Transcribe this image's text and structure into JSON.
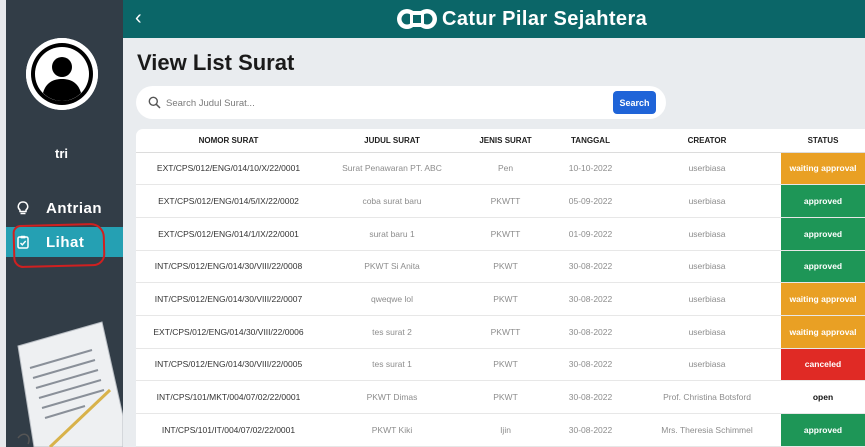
{
  "app": {
    "brand": "Catur Pilar Sejahtera"
  },
  "sidebar": {
    "username": "tri",
    "items": [
      {
        "label": "Antrian",
        "icon": "lightbulb-icon"
      },
      {
        "label": "Lihat",
        "icon": "clipboard-icon",
        "active": true
      }
    ]
  },
  "page": {
    "title": "View List Surat",
    "search": {
      "placeholder": "Search Judul Surat...",
      "button": "Search"
    }
  },
  "table": {
    "headers": [
      "NOMOR SURAT",
      "JUDUL SURAT",
      "JENIS SURAT",
      "TANGGAL",
      "CREATOR",
      "STATUS"
    ],
    "rows": [
      {
        "nomor": "EXT/CPS/012/ENG/014/10/X/22/0001",
        "judul": "Surat Penawaran PT. ABC",
        "jenis": "Pen",
        "tanggal": "10-10-2022",
        "creator": "userbiasa",
        "status": "waiting approval",
        "status_type": "waiting"
      },
      {
        "nomor": "EXT/CPS/012/ENG/014/5/IX/22/0002",
        "judul": "coba surat baru",
        "jenis": "PKWTT",
        "tanggal": "05-09-2022",
        "creator": "userbiasa",
        "status": "approved",
        "status_type": "approved"
      },
      {
        "nomor": "EXT/CPS/012/ENG/014/1/IX/22/0001",
        "judul": "surat baru 1",
        "jenis": "PKWTT",
        "tanggal": "01-09-2022",
        "creator": "userbiasa",
        "status": "approved",
        "status_type": "approved"
      },
      {
        "nomor": "INT/CPS/012/ENG/014/30/VIII/22/0008",
        "judul": "PKWT Si Anita",
        "jenis": "PKWT",
        "tanggal": "30-08-2022",
        "creator": "userbiasa",
        "status": "approved",
        "status_type": "approved"
      },
      {
        "nomor": "INT/CPS/012/ENG/014/30/VIII/22/0007",
        "judul": "qweqwe lol",
        "jenis": "PKWT",
        "tanggal": "30-08-2022",
        "creator": "userbiasa",
        "status": "waiting approval",
        "status_type": "waiting"
      },
      {
        "nomor": "EXT/CPS/012/ENG/014/30/VIII/22/0006",
        "judul": "tes surat 2",
        "jenis": "PKWTT",
        "tanggal": "30-08-2022",
        "creator": "userbiasa",
        "status": "waiting approval",
        "status_type": "waiting"
      },
      {
        "nomor": "INT/CPS/012/ENG/014/30/VIII/22/0005",
        "judul": "tes surat 1",
        "jenis": "PKWT",
        "tanggal": "30-08-2022",
        "creator": "userbiasa",
        "status": "canceled",
        "status_type": "canceled"
      },
      {
        "nomor": "INT/CPS/101/MKT/004/07/02/22/0001",
        "judul": "PKWT Dimas",
        "jenis": "PKWT",
        "tanggal": "30-08-2022",
        "creator": "Prof. Christina Botsford",
        "status": "open",
        "status_type": "open"
      },
      {
        "nomor": "INT/CPS/101/IT/004/07/02/22/0001",
        "judul": "PKWT Kiki",
        "jenis": "Ijin",
        "tanggal": "30-08-2022",
        "creator": "Mrs. Theresia Schimmel",
        "status": "approved",
        "status_type": "approved"
      }
    ]
  },
  "colors": {
    "sidebar_bg": "#323d47",
    "topbar_bg": "#0b6668",
    "active_nav": "#25a0b3",
    "search_button": "#1f64d8",
    "waiting": "#e9a024",
    "approved": "#1e9657",
    "canceled": "#e02a25"
  }
}
